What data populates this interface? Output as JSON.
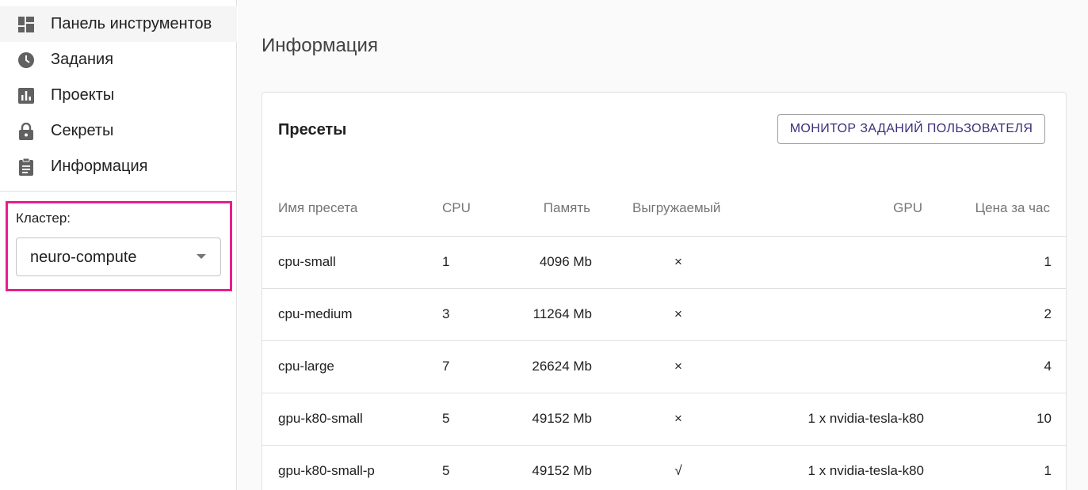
{
  "sidebar": {
    "items": [
      {
        "label": "Панель инструментов",
        "icon": "dashboard-icon",
        "active": true
      },
      {
        "label": "Задания",
        "icon": "clock-icon"
      },
      {
        "label": "Проекты",
        "icon": "bar-chart-icon"
      },
      {
        "label": "Секреты",
        "icon": "lock-icon"
      },
      {
        "label": "Информация",
        "icon": "clipboard-icon"
      }
    ],
    "cluster": {
      "label": "Кластер:",
      "value": "neuro-compute",
      "highlight_color": "#e91e8c"
    }
  },
  "main": {
    "title": "Информация",
    "card": {
      "title": "Пресеты",
      "monitor_button": "МОНИТОР ЗАДАНИЙ ПОЛЬЗОВАТЕЛЯ",
      "columns": [
        "Имя пресета",
        "CPU",
        "Память",
        "Выгружаемый",
        "GPU",
        "Цена за час"
      ],
      "rows": [
        {
          "name": "cpu-small",
          "cpu": "1",
          "memory": "4096 Mb",
          "preemptible": "×",
          "gpu": "",
          "price": "1"
        },
        {
          "name": "cpu-medium",
          "cpu": "3",
          "memory": "11264 Mb",
          "preemptible": "×",
          "gpu": "",
          "price": "2"
        },
        {
          "name": "cpu-large",
          "cpu": "7",
          "memory": "26624 Mb",
          "preemptible": "×",
          "gpu": "",
          "price": "4"
        },
        {
          "name": "gpu-k80-small",
          "cpu": "5",
          "memory": "49152 Mb",
          "preemptible": "×",
          "gpu": "1 x nvidia-tesla-k80",
          "price": "10"
        },
        {
          "name": "gpu-k80-small-p",
          "cpu": "5",
          "memory": "49152 Mb",
          "preemptible": "√",
          "gpu": "1 x nvidia-tesla-k80",
          "price": "1"
        }
      ]
    }
  }
}
